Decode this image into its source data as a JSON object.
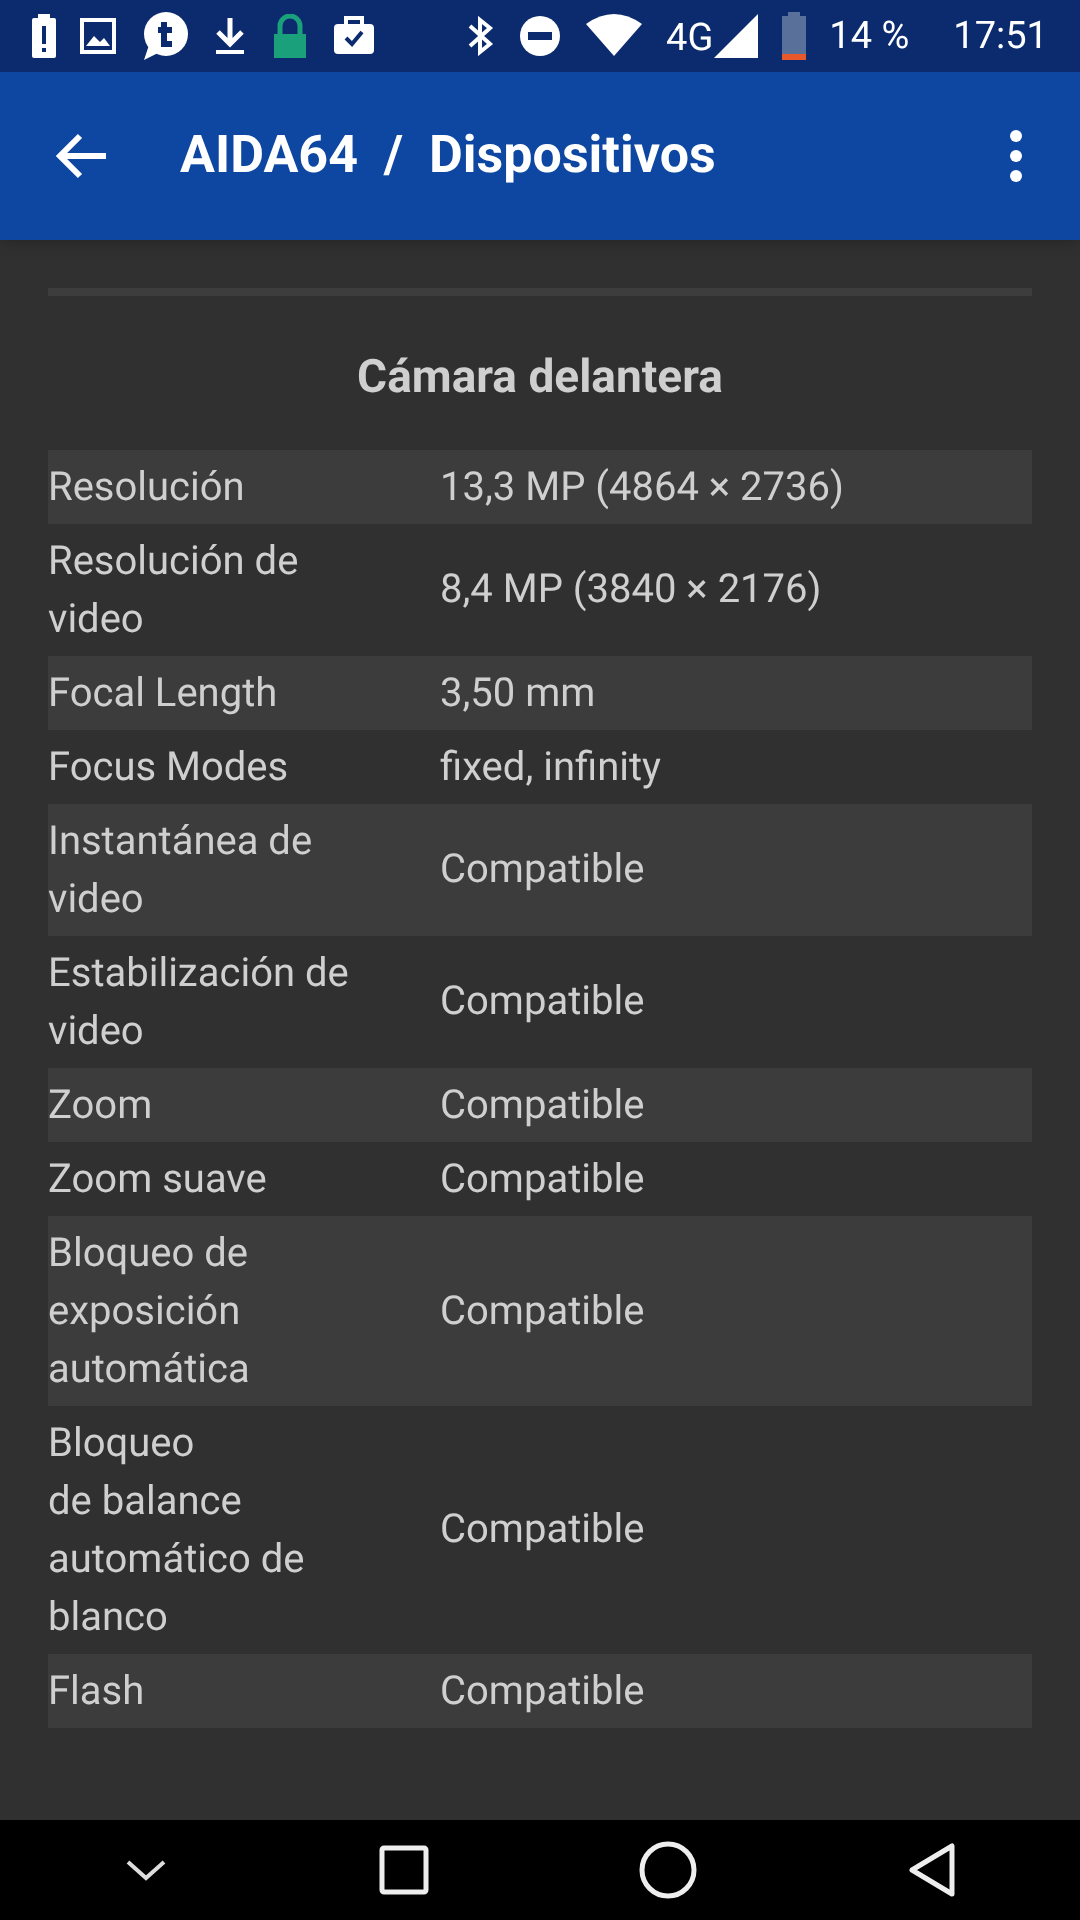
{
  "status_bar": {
    "network": "4G",
    "battery": "14 %",
    "time": "17:51"
  },
  "app_bar": {
    "title": "AIDA64  /  Dispositivos"
  },
  "section": {
    "title": "Cámara delantera"
  },
  "rows": [
    {
      "label": "Resolución",
      "value": "13,3 MP (4864 × 2736)"
    },
    {
      "label": "Resolución de\nvideo",
      "value": "8,4 MP (3840 × 2176)"
    },
    {
      "label": "Focal Length",
      "value": "3,50 mm"
    },
    {
      "label": "Focus Modes",
      "value": "fixed, infinity"
    },
    {
      "label": "Instantánea de\nvideo",
      "value": "Compatible"
    },
    {
      "label": "Estabilización de\nvideo",
      "value": "Compatible"
    },
    {
      "label": "Zoom",
      "value": "Compatible"
    },
    {
      "label": "Zoom suave",
      "value": "Compatible"
    },
    {
      "label": "Bloqueo de\nexposición\nautomática",
      "value": "Compatible"
    },
    {
      "label": "Bloqueo\nde balance\nautomático de\nblanco",
      "value": "Compatible"
    },
    {
      "label": "Flash",
      "value": "Compatible"
    }
  ]
}
